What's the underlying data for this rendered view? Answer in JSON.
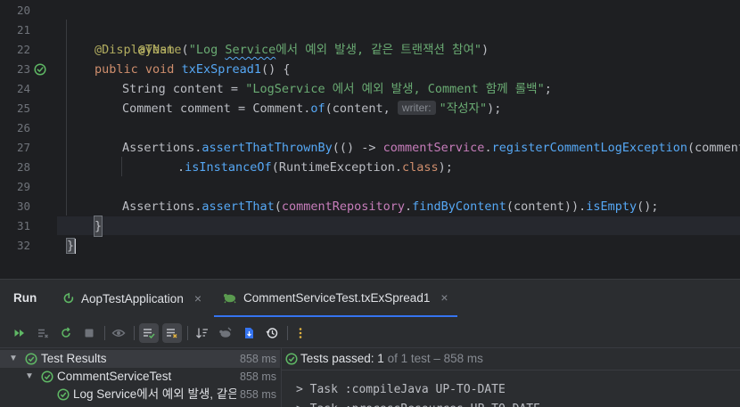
{
  "editor": {
    "line_numbers": [
      "20",
      "21",
      "22",
      "23",
      "24",
      "25",
      "26",
      "27",
      "28",
      "29",
      "30",
      "31",
      "32"
    ],
    "line23": {
      "kw1": "public",
      "kw2": "void",
      "name": "txExSpread1",
      "rest": "() {"
    },
    "line21": {
      "ann": "@Test"
    },
    "line22": {
      "ann": "@DisplayName",
      "open": "(",
      "str_a": "\"Log ",
      "str_b": "Service",
      "str_c": "에서 예외 발생, 같은 트랜잭션 참여\"",
      "close": ")"
    },
    "line24": {
      "type": "String",
      "decl": " content = ",
      "str": "\"LogService 에서 예외 발생, Comment 함께 롤백\"",
      "end": ";"
    },
    "line25": {
      "type": "Comment",
      "decl": " comment = ",
      "cls": "Comment",
      "dot": ".",
      "fn": "of",
      "args": "(content, ",
      "hint": "writer:",
      "str": "\"작성자\"",
      "end": ");"
    },
    "line27": {
      "cls": "Assertions",
      "dot": ".",
      "fn": "assertThatThrownBy",
      "mid": "(() -> ",
      "field": "commentService",
      "dot2": ".",
      "fn2": "registerCommentLogException",
      "end": "(comment))"
    },
    "line28": {
      "dot": ".",
      "fn": "isInstanceOf",
      "open": "(RuntimeException.",
      "kw": "class",
      "end": ");"
    },
    "line30": {
      "cls": "Assertions",
      "dot": ".",
      "fn": "assertThat",
      "open": "(",
      "field": "commentRepository",
      "dot2": ".",
      "fn2": "findByContent",
      "mid": "(content)).",
      "fn3": "isEmpty",
      "end": "();"
    },
    "line31": {
      "brace": "}"
    },
    "line32": {
      "brace": "}"
    }
  },
  "run_window": {
    "title": "Run",
    "tabs": [
      {
        "label": "AopTestApplication",
        "icon": "run-config-icon",
        "active": false
      },
      {
        "label": "CommentServiceTest.txExSpread1",
        "icon": "test-class-icon",
        "active": true
      }
    ],
    "close_glyph": "×"
  },
  "test_tree": {
    "rows": [
      {
        "label": "Test Results",
        "duration": "858 ms",
        "expanded": true,
        "status": "passed"
      },
      {
        "label": "CommentServiceTest",
        "duration": "858 ms",
        "expanded": true,
        "status": "passed"
      },
      {
        "label": "Log Service에서 예외 발생, 같은 트",
        "duration": "858 ms",
        "expanded": false,
        "status": "passed"
      }
    ]
  },
  "console": {
    "status_prefix": "Tests passed: ",
    "passed": "1",
    "status_suffix": " of 1 test – 858 ms",
    "lines": [
      "> Task :compileJava UP-TO-DATE",
      "> Task :processResources UP-TO-DATE"
    ]
  },
  "colors": {
    "accent": "#3574f0",
    "passed": "#5fb865",
    "keyword": "#cf8e6d",
    "string": "#6aab73",
    "method": "#56a8f5",
    "field": "#c77dbb",
    "annotation": "#b3ae60"
  }
}
